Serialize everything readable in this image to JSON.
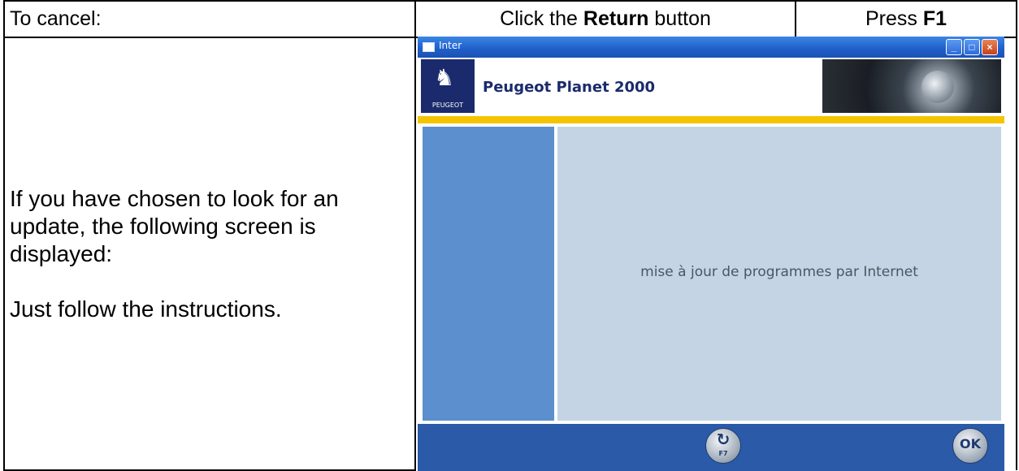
{
  "header": {
    "col1": "To cancel:",
    "col2_prefix": "Click the ",
    "col2_bold": "Return",
    "col2_suffix": " button",
    "col3_prefix": "Press ",
    "col3_bold": "F1"
  },
  "instructions": {
    "para1_line1": "If you have chosen to look for an",
    "para1_line2": "update, the following screen is",
    "para1_line3": "displayed:",
    "para2": "Just follow the instructions."
  },
  "window": {
    "title": "Inter",
    "app_title": "Peugeot Planet 2000",
    "brand": "PEUGEOT",
    "message": "mise à jour de programmes par Internet",
    "return_key": "F7",
    "ok_label": "OK"
  },
  "colors": {
    "titlebar": "#1f5ec8",
    "accent_strip": "#f5c400",
    "side_panel": "#5b8fcd",
    "main_panel": "#c4d4e4",
    "footer": "#2a5aa8"
  },
  "icons": {
    "logo": "peugeot-lion-icon",
    "return": "return-arrow-icon",
    "ok": "ok-icon"
  }
}
